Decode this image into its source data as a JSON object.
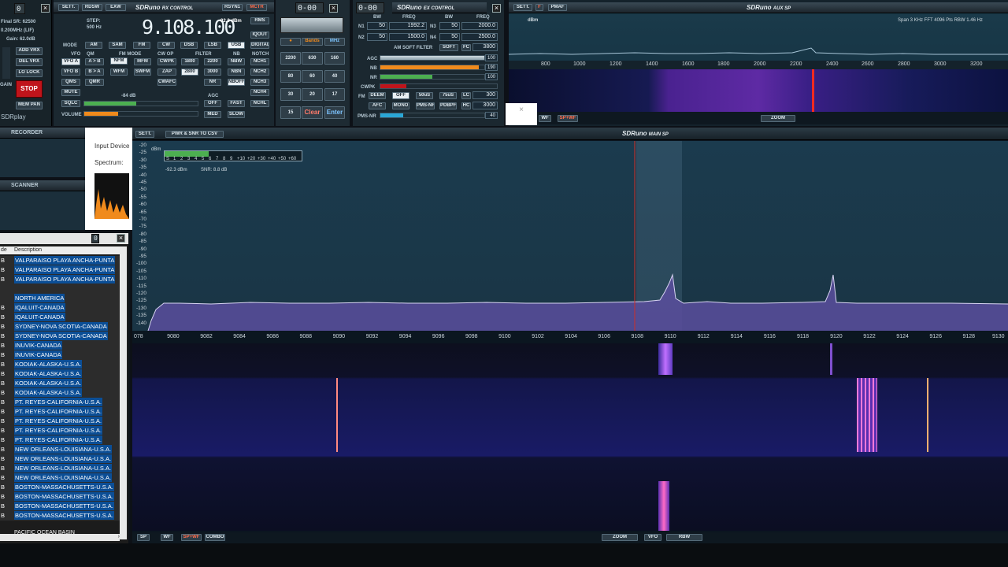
{
  "app": {
    "name": "SDRplay"
  },
  "left_status": {
    "final_sr": "Final SR: 62500",
    "rate": "0.200MHz (LIF)",
    "gain": "Gain: 62.0dB",
    "add_vrx": "ADD VRX",
    "del_vrx": "DEL VRX",
    "lo_lock": "LO LOCK",
    "gain_lbl": "GAIN",
    "stop": "STOP",
    "mem_pan": "MEM PAN",
    "sdrplay": "SDRplay",
    "top_seg": "0"
  },
  "rx": {
    "title": "SDRuno",
    "subtitle": "RX CONTROL",
    "sett": "SETT.",
    "rdsw": "RDSW",
    "exw": "EXW",
    "rsyn1": "RSYN1",
    "mctr": "MCTR",
    "tctr": "TCTR",
    "seg": "0-00",
    "step_lbl": "STEP:",
    "step_val": "500 Hz",
    "freq": "9.108.100",
    "dbm": "-92.3 dBm",
    "rms": "RMS",
    "iqout": "IQOUT",
    "digital": "DIGITAL",
    "mode_lbl": "MODE",
    "modes": [
      "AM",
      "SAM",
      "FM",
      "CW",
      "DSB",
      "LSB",
      "USB"
    ],
    "vfo_lbl": "VFO",
    "qm_lbl": "QM",
    "fm_mode_lbl": "FM MODE",
    "cw_op_lbl": "CW OP",
    "filter_lbl": "FILTER",
    "nb_lbl": "NB",
    "notch_lbl": "NOTCH",
    "vfo_a": "VFO A",
    "ab": "A > B",
    "nfm": "NFM",
    "mfm": "MFM",
    "cwpk": "CWPK",
    "f1800": "1800",
    "f2200": "2200",
    "nbw": "NBW",
    "nch1": "NCH1",
    "vfo_b": "VFO B",
    "ba": "B > A",
    "wfm": "WFM",
    "swfm": "SWFM",
    "zap": "ZAP",
    "f2800": "2800",
    "f3000": "3000",
    "nbn": "NBN",
    "nch2": "NCH2",
    "qms": "QMS",
    "qmr": "QMR",
    "cwafc": "CWAFC",
    "nr": "NR",
    "nboff": "NBOFF",
    "nch3": "NCH3",
    "nch4": "NCH4",
    "mute": "MUTE",
    "sqlc": "SQLC",
    "volume": "VOLUME",
    "sq_db": "-84 dB",
    "agc_lbl": "AGC",
    "off": "OFF",
    "fast": "FAST",
    "med": "MED",
    "slow": "SLOW",
    "nchl": "NCHL"
  },
  "keypad": {
    "bands": "Bands",
    "mhz": "MHz",
    "keys": [
      "2200",
      "630",
      "160",
      "80",
      "60",
      "40",
      "30",
      "20",
      "17",
      "15"
    ],
    "clear": "Clear",
    "enter": "Enter"
  },
  "ex": {
    "title": "SDRuno",
    "subtitle": "EX CONTROL",
    "seg": "0-00",
    "bw": "BW",
    "freq": "FREQ",
    "n1": "N1",
    "n1_bw": "50",
    "n1_freq": "1992.2",
    "n3": "N3",
    "n3_bw": "50",
    "n3_freq": "2000.0",
    "n2": "N2",
    "n2_bw": "50",
    "n2_freq": "1500.0",
    "n4": "N4",
    "n4_bw": "50",
    "n4_freq": "2500.0",
    "am_soft": "AM SOFT FILTER",
    "soft": "SOFT",
    "fc": "FC",
    "fc_val": "3800",
    "agc": "AGC",
    "agc_val": "100",
    "nb": "NB",
    "nb_val": "190",
    "nr": "NR",
    "nr_val": "100",
    "cwpk": "CWPK",
    "fm": "FM",
    "deem": "DEEM",
    "off": "OFF",
    "us50": "50uS",
    "us75": "75uS",
    "lc": "LC",
    "lc_val": "300",
    "afc": "AFC",
    "mono": "MONO",
    "pmsnr": "PMS-NR",
    "pdbpf": "PDBPF",
    "hc": "HC",
    "hc_val": "3000",
    "pmsnr2": "PMS-NR",
    "pms_val": "40"
  },
  "aux": {
    "title": "SDRuno",
    "subtitle": "AUX SP",
    "sett": "SETT.",
    "f": "F",
    "pmaf": "PMAF",
    "dbm": "dBm",
    "info": "Span 3 KHz   FFT 4096 Pts   RBW 1.46 Hz",
    "xticks": [
      "800",
      "1000",
      "1200",
      "1400",
      "1600",
      "1800",
      "2000",
      "2200",
      "2400",
      "2600",
      "2800",
      "3000",
      "3200"
    ],
    "wf": "WF",
    "spwf": "SP+WF",
    "zoom": "ZOOM"
  },
  "recorder": {
    "title": "RECORDER",
    "input": "Input Device",
    "spectrum": "Spectrum:"
  },
  "scanner": {
    "title": "SCANNER"
  },
  "memory": {
    "col_mode": "de",
    "col_desc": "Description",
    "seg": "0",
    "rows": [
      {
        "b": "B",
        "d": "VALPARAISO PLAYA ANCHA-PUNTA"
      },
      {
        "b": "B",
        "d": "VALPARAISO PLAYA ANCHA-PUNTA"
      },
      {
        "b": "B",
        "d": "VALPARAISO PLAYA ANCHA-PUNTA"
      },
      {
        "b": "",
        "d": ""
      },
      {
        "b": "",
        "d": "NORTH AMERICA"
      },
      {
        "b": "B",
        "d": "IQALUIT-CANADA"
      },
      {
        "b": "B",
        "d": "IQALUIT-CANADA"
      },
      {
        "b": "B",
        "d": "SYDNEY-NOVA SCOTIA-CANADA"
      },
      {
        "b": "B",
        "d": "SYDNEY-NOVA SCOTIA-CANADA"
      },
      {
        "b": "B",
        "d": "INUVIK-CANADA"
      },
      {
        "b": "B",
        "d": "INUVIK-CANADA"
      },
      {
        "b": "B",
        "d": "KODIAK-ALASKA-U.S.A."
      },
      {
        "b": "B",
        "d": "KODIAK-ALASKA-U.S.A."
      },
      {
        "b": "B",
        "d": "KODIAK-ALASKA-U.S.A."
      },
      {
        "b": "B",
        "d": "KODIAK-ALASKA-U.S.A."
      },
      {
        "b": "B",
        "d": "PT. REYES-CALIFORNIA-U.S.A."
      },
      {
        "b": "B",
        "d": "PT. REYES-CALIFORNIA-U.S.A."
      },
      {
        "b": "B",
        "d": "PT. REYES-CALIFORNIA-U.S.A."
      },
      {
        "b": "B",
        "d": "PT. REYES-CALIFORNIA-U.S.A."
      },
      {
        "b": "B",
        "d": "PT. REYES-CALIFORNIA-U.S.A."
      },
      {
        "b": "B",
        "d": "NEW ORLEANS-LOUISIANA-U.S.A."
      },
      {
        "b": "B",
        "d": "NEW ORLEANS-LOUISIANA-U.S.A."
      },
      {
        "b": "B",
        "d": "NEW ORLEANS-LOUISIANA-U.S.A."
      },
      {
        "b": "B",
        "d": "NEW ORLEANS-LOUISIANA-U.S.A."
      },
      {
        "b": "B",
        "d": "BOSTON-MASSACHUSETTS-U.S.A."
      },
      {
        "b": "B",
        "d": "BOSTON-MASSACHUSETTS-U.S.A."
      },
      {
        "b": "B",
        "d": "BOSTON-MASSACHUSETTS-U.S.A."
      },
      {
        "b": "B",
        "d": "BOSTON-MASSACHUSETTS-U.S.A."
      }
    ],
    "partial": "PACIFIC OCEAN BASIN"
  },
  "main": {
    "title": "SDRuno",
    "subtitle": "MAIN SP",
    "sett": "SETT.",
    "csv": "PWR & SNR TO CSV",
    "dbm": "dBm",
    "smeter": [
      "S",
      "1",
      "2",
      "3",
      "4",
      "5",
      "6",
      "7",
      "8",
      "9",
      "+10",
      "+20",
      "+30",
      "+40",
      "+50",
      "+60"
    ],
    "level": "-92.3 dBm",
    "snr": "SNR: 8.8 dB",
    "yticks": [
      "-20",
      "-25",
      "-30",
      "-35",
      "-40",
      "-45",
      "-50",
      "-55",
      "-60",
      "-65",
      "-70",
      "-75",
      "-80",
      "-85",
      "-90",
      "-95",
      "-100",
      "-105",
      "-110",
      "-115",
      "-120",
      "-125",
      "-130",
      "-135",
      "-140"
    ],
    "xticks": [
      "078",
      "9080",
      "9082",
      "9084",
      "9086",
      "9088",
      "9090",
      "9092",
      "9094",
      "9096",
      "9098",
      "9100",
      "9102",
      "9104",
      "9106",
      "9108",
      "9110",
      "9112",
      "9114",
      "9116",
      "9118",
      "9120",
      "9122",
      "9124",
      "9126",
      "9128",
      "9130"
    ],
    "bottom": {
      "sp": "SP",
      "wf": "WF",
      "spwf": "SP+WF",
      "combo": "COMBO",
      "zoom": "ZOOM",
      "vfo": "VFO",
      "rbw": "RBW"
    }
  },
  "colors": {
    "bg": "#0d1117",
    "panel": "#1b2830",
    "accent_green": "#4caf50",
    "accent_orange": "#f08a1c",
    "stop_red": "#c0141b",
    "spectrum_fill": "#5a4d9e",
    "vfo_line": "#d0302a"
  }
}
